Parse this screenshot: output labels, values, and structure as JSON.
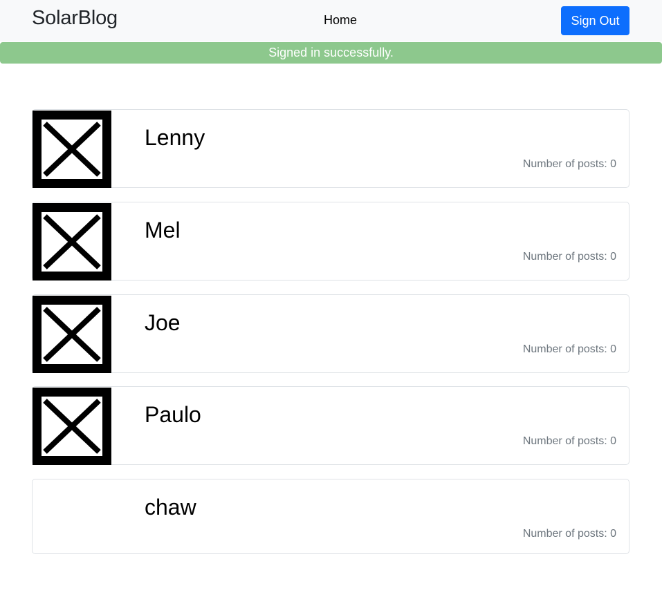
{
  "navbar": {
    "brand": "SolarBlog",
    "home_label": "Home",
    "signout_label": "Sign Out"
  },
  "notice": "Signed in successfully.",
  "users": [
    {
      "name": "Lenny",
      "posts_label": "Number of posts: 0",
      "photo": "broken-image-icon"
    },
    {
      "name": "Mel",
      "posts_label": "Number of posts: 0",
      "photo": "broken-image-icon"
    },
    {
      "name": "Joe",
      "posts_label": "Number of posts: 0",
      "photo": "broken-image-icon"
    },
    {
      "name": "Paulo",
      "posts_label": "Number of posts: 0",
      "photo": "broken-image-icon"
    },
    {
      "name": "chaw",
      "posts_label": "Number of posts: 0",
      "photo": null
    }
  ],
  "colors": {
    "navbar_bg": "#f8f9fa",
    "primary": "#0d6efd",
    "notice_bg": "#8dc88d",
    "muted": "#6c757d"
  }
}
